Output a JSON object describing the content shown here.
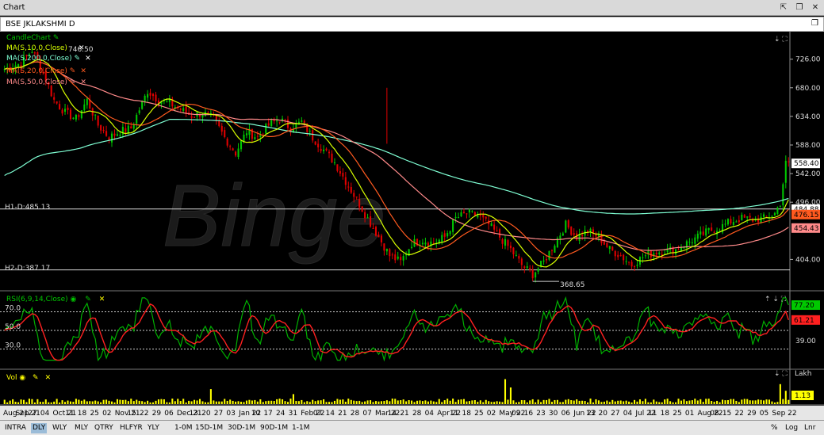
{
  "window": {
    "title": "Chart"
  },
  "symbol_bar": {
    "symbol": "BSE JKLAKSHMI D"
  },
  "legend": {
    "candle": "CandleChart",
    "ma10": "MA(S,10,0,Close)",
    "ma200": "MA(S,200,0,Close)",
    "ma20": "MA(S,20,0,Close)",
    "ma50": "MA(S,50,0,Close)",
    "rsi": "RSI(6,9,14,Close)",
    "vol": "Vol"
  },
  "colors": {
    "candle_up": "#00c800",
    "candle_down": "#e00000",
    "ma10": "#d8ff00",
    "ma20": "#ff5a1f",
    "ma50": "#ff8a8a",
    "ma200": "#7fffd4",
    "rsi_line": "#00b000",
    "rsi_signal": "#ff2020"
  },
  "annotations": {
    "high_label": "746.50",
    "low_label": "368.65",
    "h1": "H1-D:485.13",
    "h2": "H2-D:387.17",
    "watermark": "Binge"
  },
  "price_axis": {
    "ticks": [
      "726.00",
      "680.00",
      "634.00",
      "588.00",
      "542.00",
      "496.00",
      "404.00"
    ],
    "badges": [
      {
        "text": "558.40",
        "bg": "#ffffff",
        "fg": "#000000",
        "price": 558.4
      },
      {
        "text": "484.88",
        "bg": "#ffffff",
        "fg": "#000000",
        "price": 484.88
      },
      {
        "text": "476.15",
        "bg": "#ff5a1f",
        "fg": "#000000",
        "price": 476.15
      },
      {
        "text": "454.43",
        "bg": "#ff8a8a",
        "fg": "#000000",
        "price": 454.43
      }
    ]
  },
  "rsi_axis": {
    "left_levels": [
      "70.0",
      "50.0",
      "30.0"
    ],
    "right_ticks": [
      "39.00"
    ],
    "badges": [
      {
        "text": "77.20",
        "bg": "#00c800",
        "fg": "#000000",
        "value": 77.2
      },
      {
        "text": "61.21",
        "bg": "#ff2020",
        "fg": "#000000",
        "value": 61.21
      }
    ]
  },
  "vol_axis": {
    "label": "Lakh",
    "badge": "1.13"
  },
  "date_axis": [
    "Aug 21",
    "Sep 21",
    "27",
    "04",
    "Oct 21",
    "11",
    "18",
    "25",
    "02",
    "Nov 21",
    "15",
    "22",
    "29",
    "06",
    "Dec 21",
    "13",
    "20",
    "27",
    "03",
    "Jan 22",
    "10",
    "17",
    "24",
    "31",
    "Feb 22",
    "07",
    "14",
    "21",
    "28",
    "07",
    "Mar 22",
    "14",
    "21",
    "28",
    "04",
    "Apr 22",
    "11",
    "18",
    "25",
    "02",
    "May 22",
    "09",
    "16",
    "23",
    "30",
    "06",
    "Jun 22",
    "13",
    "20",
    "27",
    "04",
    "Jul 22",
    "11",
    "18",
    "25",
    "01",
    "Aug 22",
    "08",
    "15",
    "22",
    "29",
    "05",
    "Sep 22"
  ],
  "bottom_bar": {
    "timeframes": [
      "INTRA",
      "DLY",
      "WLY",
      "MLY",
      "QTRY",
      "HLFYR",
      "YLY"
    ],
    "active": "DLY",
    "ranges": [
      "1-0M",
      "15D-1M",
      "30D-1M",
      "90D-1M",
      "1-1M"
    ],
    "right": [
      "%",
      "Log",
      "Lnr"
    ]
  },
  "chart_data": {
    "type": "candlestick",
    "price_range": [
      365,
      760
    ],
    "rsi_range": [
      10,
      90
    ],
    "hlines": [
      485.13,
      387.17
    ],
    "anchors": [
      [
        0,
        710
      ],
      [
        6,
        720
      ],
      [
        10,
        740
      ],
      [
        14,
        705
      ],
      [
        18,
        660
      ],
      [
        22,
        640
      ],
      [
        26,
        630
      ],
      [
        30,
        660
      ],
      [
        34,
        620
      ],
      [
        38,
        600
      ],
      [
        42,
        610
      ],
      [
        46,
        615
      ],
      [
        52,
        675
      ],
      [
        56,
        660
      ],
      [
        60,
        655
      ],
      [
        64,
        645
      ],
      [
        68,
        635
      ],
      [
        72,
        640
      ],
      [
        76,
        630
      ],
      [
        80,
        600
      ],
      [
        84,
        575
      ],
      [
        88,
        610
      ],
      [
        92,
        600
      ],
      [
        96,
        620
      ],
      [
        100,
        630
      ],
      [
        104,
        615
      ],
      [
        108,
        625
      ],
      [
        112,
        600
      ],
      [
        116,
        580
      ],
      [
        120,
        560
      ],
      [
        124,
        530
      ],
      [
        128,
        500
      ],
      [
        132,
        470
      ],
      [
        136,
        440
      ],
      [
        140,
        410
      ],
      [
        144,
        400
      ],
      [
        148,
        430
      ],
      [
        152,
        435
      ],
      [
        156,
        430
      ],
      [
        160,
        440
      ],
      [
        164,
        470
      ],
      [
        168,
        478
      ],
      [
        172,
        475
      ],
      [
        176,
        460
      ],
      [
        180,
        440
      ],
      [
        184,
        420
      ],
      [
        188,
        395
      ],
      [
        192,
        380
      ],
      [
        196,
        400
      ],
      [
        200,
        430
      ],
      [
        204,
        460
      ],
      [
        208,
        440
      ],
      [
        212,
        450
      ],
      [
        216,
        440
      ],
      [
        220,
        420
      ],
      [
        224,
        410
      ],
      [
        228,
        395
      ],
      [
        232,
        408
      ],
      [
        236,
        415
      ],
      [
        240,
        418
      ],
      [
        244,
        420
      ],
      [
        248,
        430
      ],
      [
        252,
        440
      ],
      [
        256,
        450
      ],
      [
        260,
        455
      ],
      [
        264,
        465
      ],
      [
        268,
        470
      ],
      [
        272,
        468
      ],
      [
        276,
        470
      ],
      [
        280,
        478
      ],
      [
        282,
        495
      ],
      [
        284,
        558
      ]
    ],
    "volume_spikes": [
      [
        75,
        0.45
      ],
      [
        105,
        0.3
      ],
      [
        182,
        0.75
      ],
      [
        184,
        0.5
      ],
      [
        282,
        0.6
      ],
      [
        284,
        0.4
      ]
    ]
  }
}
